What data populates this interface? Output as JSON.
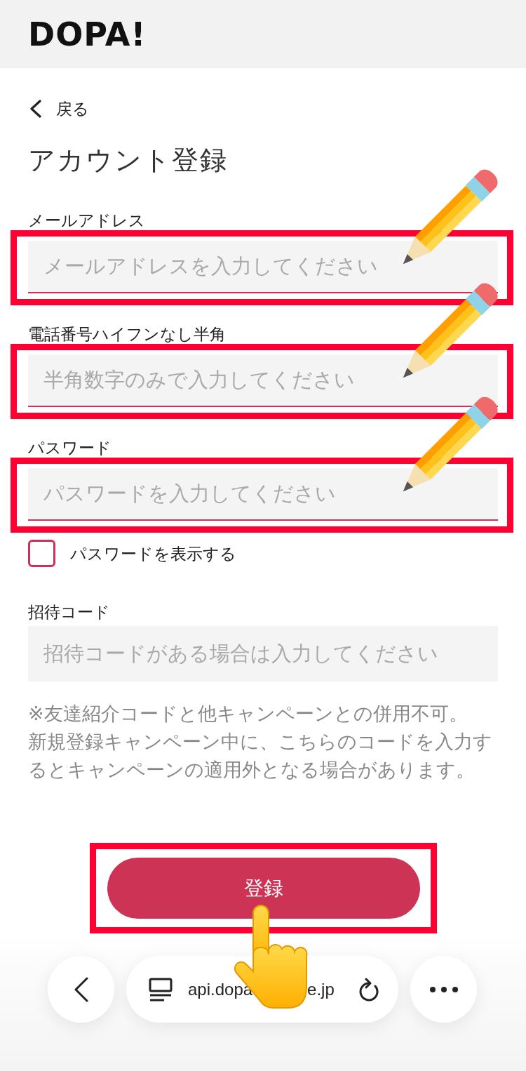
{
  "header": {
    "logo": "DOPA!"
  },
  "back_link": {
    "label": "戻る"
  },
  "title": "アカウント登録",
  "fields": [
    {
      "kind": "input",
      "label": "メールアドレス",
      "placeholder": "メールアドレスを入力してください",
      "underlined": true,
      "highlighted": true,
      "pencil": true
    },
    {
      "kind": "input",
      "label": "電話番号ハイフンなし半角",
      "placeholder": "半角数字のみで入力してください",
      "underlined": true,
      "highlighted": true,
      "pencil": true
    },
    {
      "kind": "input",
      "label": "パスワード",
      "placeholder": "パスワードを入力してください",
      "underlined": true,
      "highlighted": true,
      "pencil": true
    },
    {
      "kind": "checkbox",
      "label": "パスワードを表示する",
      "checked": false
    },
    {
      "kind": "input",
      "label": "招待コード",
      "placeholder": "招待コードがある場合は入力してください",
      "underlined": false,
      "highlighted": false,
      "pencil": false
    }
  ],
  "notice": [
    "※友達紹介コードと他キャンペーンとの併用不可。",
    "新規登録キャンペーン中に、こちらのコードを入力するとキャンペーンの適用外となる場合があります。"
  ],
  "submit_button": {
    "label": "登録",
    "highlighted": true,
    "pointer": true
  },
  "browser_bar": {
    "url_start": "api.dopa",
    "url_end": "e.jp"
  }
}
